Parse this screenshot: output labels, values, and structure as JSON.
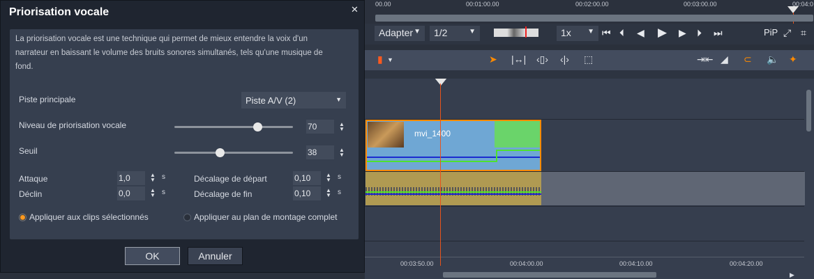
{
  "dialog": {
    "title": "Priorisation vocale",
    "close": "✕",
    "description": "La priorisation vocale est une technique qui permet de mieux entendre la voix d'un narrateur en baissant le volume des bruits sonores simultanés, tels qu'une musique de fond.",
    "main_track_label": "Piste principale",
    "main_track_value": "Piste A/V (2)",
    "level_label": "Niveau de priorisation vocale",
    "level_value": "70",
    "level_fraction": 0.7,
    "threshold_label": "Seuil",
    "threshold_value": "38",
    "threshold_fraction": 0.38,
    "attack_label": "Attaque",
    "attack_value": "1,0",
    "decay_label": "Déclin",
    "decay_value": "0,0",
    "start_offset_label": "Décalage de départ",
    "start_offset_value": "0,10",
    "end_offset_label": "Décalage de fin",
    "end_offset_value": "0,10",
    "unit": "s",
    "radio_selected": "Appliquer aux clips sélectionnés",
    "radio_all": "Appliquer au plan de montage complet",
    "ok": "OK",
    "cancel": "Annuler"
  },
  "player": {
    "ruler": [
      "00.00",
      "00:01:00.00",
      "00:02:00.00",
      "00:03:00.00",
      "00:04:0"
    ],
    "fit": "Adapter",
    "quality": "1/2",
    "speed": "1x",
    "pip": "PiP"
  },
  "timeline": {
    "clip_name": "mvi_1400",
    "ruler": [
      "00:03:50.00",
      "00:04:00.00",
      "00:04:10.00",
      "00:04:20.00"
    ]
  },
  "colors": {
    "accent": "#ff8a00",
    "playhead": "#e8541c",
    "video_clip": "#6fa7d4",
    "audio_clip": "#b09a52"
  }
}
